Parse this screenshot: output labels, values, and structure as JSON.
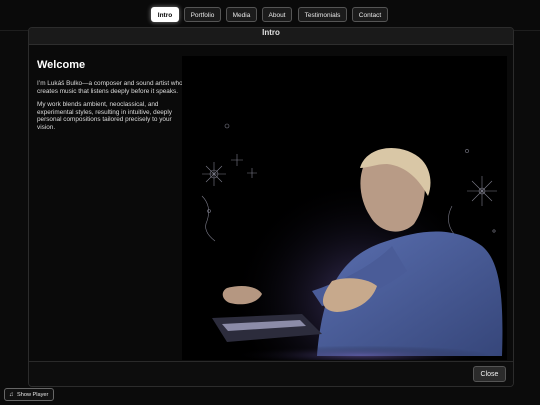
{
  "nav": {
    "items": [
      {
        "label": "Intro",
        "active": true
      },
      {
        "label": "Portfolio",
        "active": false
      },
      {
        "label": "Media",
        "active": false
      },
      {
        "label": "About",
        "active": false
      },
      {
        "label": "Testimonials",
        "active": false
      },
      {
        "label": "Contact",
        "active": false
      }
    ]
  },
  "modal": {
    "title": "Intro",
    "heading": "Welcome",
    "paragraph1": "I’m Lukáš Bulko—a composer and sound artist who creates music that listens deeply before it speaks.",
    "paragraph2": "My work blends ambient, neoclassical, and experimental styles, resulting in intuitive, deeply personal compositions tailored precisely to your vision.",
    "close_label": "Close",
    "image": "musician-at-keyboard-photo"
  },
  "player": {
    "label": "Show Player",
    "icon": "music-note-icon"
  }
}
